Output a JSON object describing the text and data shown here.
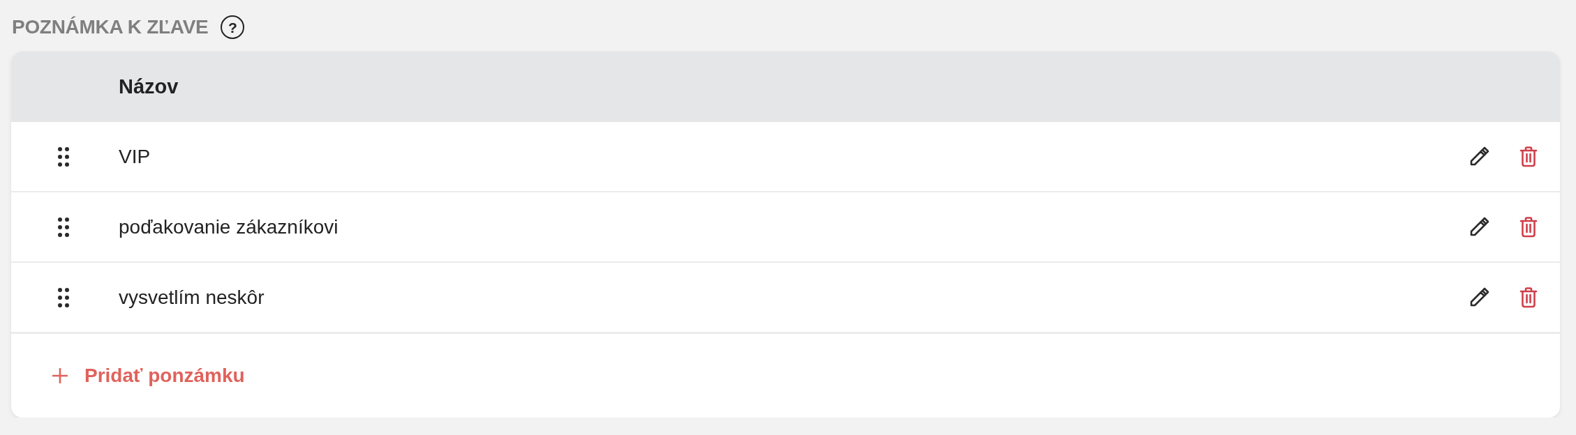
{
  "section": {
    "title": "POZNÁMKA K ZĽAVE",
    "help_icon": "?"
  },
  "table": {
    "columns": [
      "Názov"
    ],
    "rows": [
      {
        "name": "VIP"
      },
      {
        "name": "poďakovanie zákazníkovi"
      },
      {
        "name": "vysvetlím neskôr"
      }
    ]
  },
  "add_button": {
    "label": "Pridať ponzámku"
  }
}
